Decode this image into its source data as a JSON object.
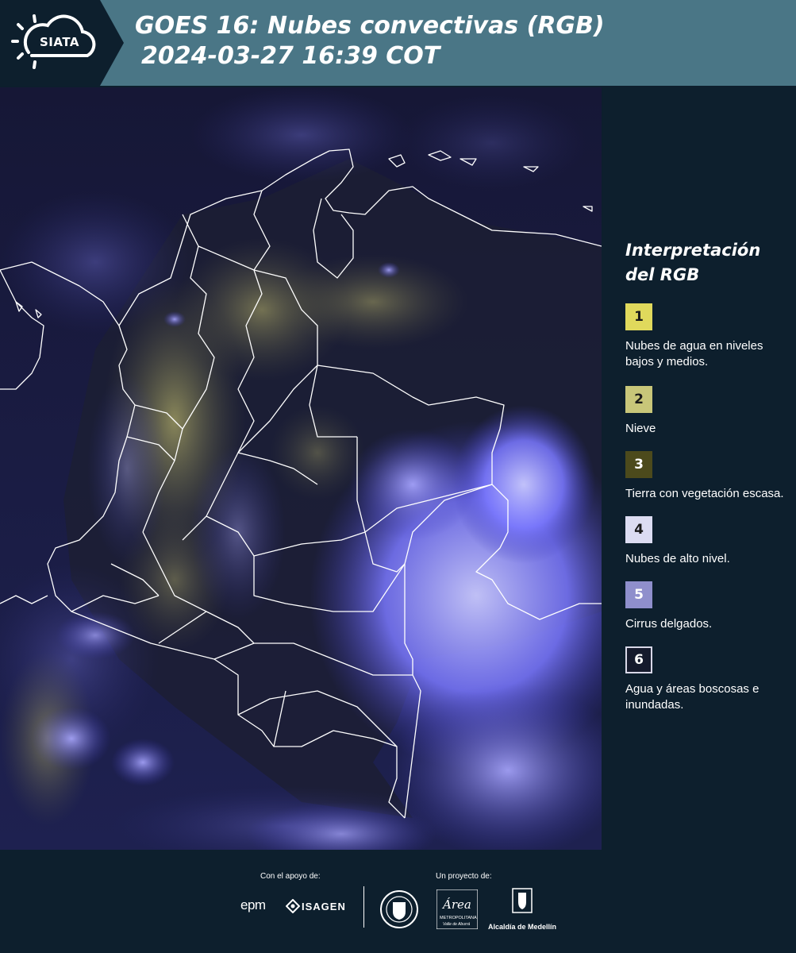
{
  "header": {
    "logo_text": "SIATA",
    "title_line1": "GOES 16: Nubes convectivas (RGB)",
    "title_line2": "2024-03-27 16:39 COT"
  },
  "map": {
    "icon": "satellite-rgb-map"
  },
  "legend": {
    "title_line1": "Interpretación",
    "title_line2": "del RGB",
    "items": [
      {
        "number": "1",
        "label": "Nubes de agua en niveles bajos y medios.",
        "color": "#e0d95c"
      },
      {
        "number": "2",
        "label": "Nieve",
        "color": "#c8c679"
      },
      {
        "number": "3",
        "label": "Tierra con vegetación escasa.",
        "color": "#4c4a1c"
      },
      {
        "number": "4",
        "label": "Nubes de alto nivel.",
        "color": "#dcdcf2"
      },
      {
        "number": "5",
        "label": "Cirrus delgados.",
        "color": "#8f8fcc"
      },
      {
        "number": "6",
        "label": "Agua y áreas boscosas e inundadas.",
        "color": "#151a2c"
      }
    ]
  },
  "footer": {
    "support_label": "Con el apoyo de:",
    "project_label": "Un proyecto de:",
    "epm": "epm",
    "isagen": "ISAGEN",
    "area_line1": "Área",
    "area_line2": "METROPOLITANA",
    "area_line3": "Valle de Aburrá",
    "alcaldia": "Alcaldía de Medellín"
  }
}
